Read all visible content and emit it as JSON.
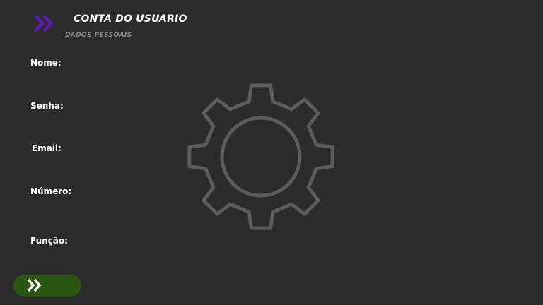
{
  "header": {
    "title": "CONTA DO USUARIO",
    "subtitle": "DADOS PESSOAIS",
    "back_icon": "double-chevron-right-icon",
    "accent_color": "#5b1db0"
  },
  "form": {
    "labels": {
      "nome": "Nome:",
      "senha": "Senha:",
      "email": "Email:",
      "numero": "Número:",
      "funcao": "Função:"
    }
  },
  "decoration": {
    "icon": "gear-icon",
    "color": "#5c5c5c"
  },
  "footer": {
    "next_button_icon": "double-chevron-right-icon",
    "button_color": "#2b560f"
  }
}
